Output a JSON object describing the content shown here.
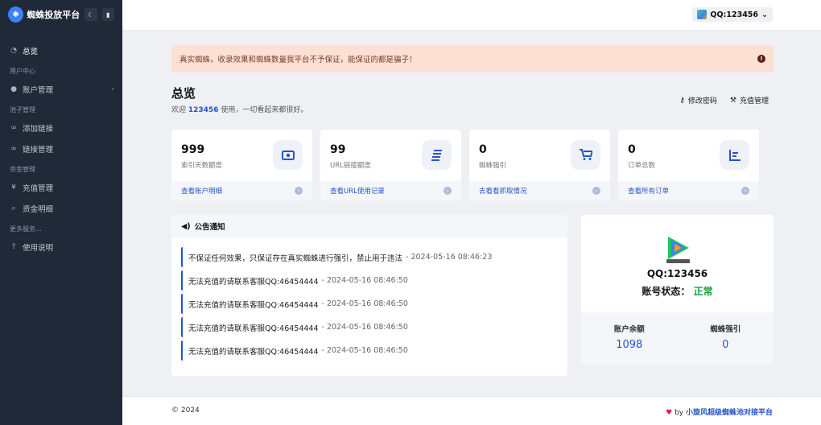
{
  "brand": {
    "name": "蜘蛛投放平台",
    "logo_icon": "spider-icon",
    "theme_toggle_icon": "moon-icon",
    "notify_icon": "bell-icon"
  },
  "sidebar": {
    "items": [
      {
        "label": "总览",
        "icon": "dashboard-icon",
        "glyph": "◔"
      },
      {
        "section": "用户中心"
      },
      {
        "label": "账户管理",
        "icon": "user-icon",
        "glyph": "👤",
        "chevron": "‹"
      },
      {
        "section": "池子管理"
      },
      {
        "label": "添加链接",
        "icon": "link-icon",
        "glyph": "∞"
      },
      {
        "label": "链接管理",
        "icon": "link-icon",
        "glyph": "∞"
      },
      {
        "section": "资金管理"
      },
      {
        "label": "充值管理",
        "icon": "yen-icon",
        "glyph": "¥"
      },
      {
        "label": "资金明细",
        "icon": "search-icon",
        "glyph": "⌕"
      },
      {
        "section": "更多服务…"
      },
      {
        "label": "使用说明",
        "icon": "help-icon",
        "glyph": "?"
      }
    ]
  },
  "topbar": {
    "user_label": "QQ:123456",
    "chevron": "⌄"
  },
  "alert": {
    "text": "真实蜘蛛，收录效果和蜘蛛数量我平台不予保证，能保证的都是骗子！",
    "icon": "!"
  },
  "header": {
    "title": "总览",
    "welcome_prefix": "欢迎",
    "welcome_user": "123456",
    "welcome_suffix": "使用，一切看起来都很好。",
    "actions": [
      {
        "label": "修改密码",
        "icon": "key-icon",
        "glyph": "⚷"
      },
      {
        "label": "充值管理",
        "icon": "wrench-icon",
        "glyph": "⚒"
      }
    ]
  },
  "stats": [
    {
      "value": "999",
      "label": "索引天数额度",
      "link": "查看账户明细",
      "icon": "money-icon",
      "glyph": "▣"
    },
    {
      "value": "99",
      "label": "URL链接额度",
      "link": "查看URL使用记录",
      "icon": "list-icon",
      "glyph": "≣"
    },
    {
      "value": "0",
      "label": "蜘蛛强引",
      "link": "去看看抓取情况",
      "icon": "cart-icon",
      "glyph": "🛒"
    },
    {
      "value": "0",
      "label": "订单总数",
      "link": "查看所有订单",
      "icon": "chart-icon",
      "glyph": "▙"
    }
  ],
  "notice": {
    "title": "公告通知",
    "icon": "megaphone-icon",
    "items": [
      {
        "text": "不保证任何效果，只保证存在真实蜘蛛进行强引，禁止用于违法",
        "time": "- 2024-05-16 08:46:23"
      },
      {
        "text": "无法充值的请联系客服QQ:46454444",
        "time": "- 2024-05-16 08:46:50"
      },
      {
        "text": "无法充值的请联系客服QQ:46454444",
        "time": "- 2024-05-16 08:46:50"
      },
      {
        "text": "无法充值的请联系客服QQ:46454444",
        "time": "- 2024-05-16 08:46:50"
      },
      {
        "text": "无法充值的请联系客服QQ:46454444",
        "time": "- 2024-05-16 08:46:50"
      }
    ]
  },
  "account": {
    "logo_icon": "tencent-video-logo",
    "qq": "QQ:123456",
    "status_label": "账号状态：",
    "status_value": "正常",
    "balance_label": "账户余额",
    "balance_value": "1098",
    "spider_label": "蜘蛛强引",
    "spider_value": "0"
  },
  "footer": {
    "copyright": "© 2024",
    "credit_prefix": "by",
    "credit_link": "小旋风超级蜘蛛池对接平台"
  },
  "colors": {
    "sidebar": "#1f2937",
    "accent": "#2753c9",
    "alert_bg": "#fbe0d3",
    "status_ok": "#1a9e3b"
  }
}
